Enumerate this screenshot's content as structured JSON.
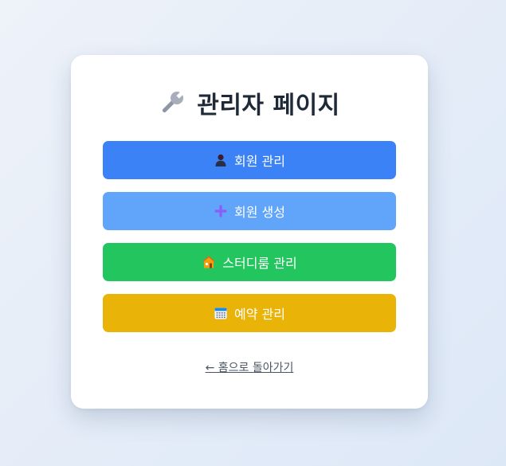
{
  "page": {
    "title": "관리자 페이지",
    "title_icon": "wrench-icon"
  },
  "buttons": [
    {
      "label": "회원 관리",
      "icon": "user-icon",
      "color": "#3b82f6"
    },
    {
      "label": "회원 생성",
      "icon": "plus-icon",
      "color": "#60a5fa"
    },
    {
      "label": "스터디룸 관리",
      "icon": "house-icon",
      "color": "#22c55e"
    },
    {
      "label": "예약 관리",
      "icon": "calendar-icon",
      "color": "#eab308"
    }
  ],
  "back_link": {
    "label": "← 홈으로 돌아가기"
  },
  "colors": {
    "background": "#e6edf8",
    "card": "#ffffff",
    "title_text": "#1f2937",
    "link_text": "#4b5563"
  }
}
